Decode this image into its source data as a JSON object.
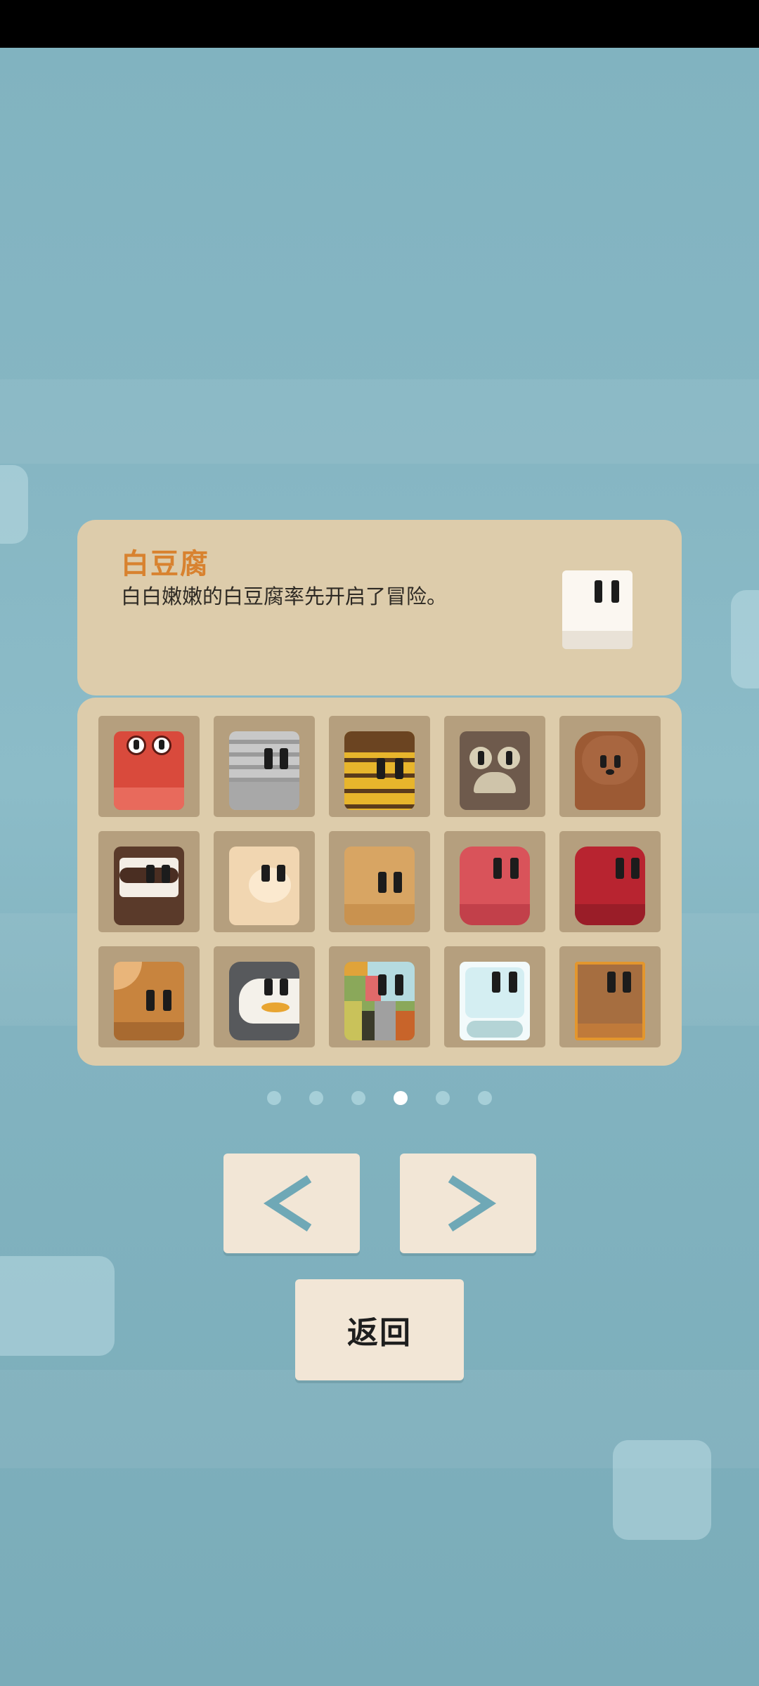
{
  "status_bar": {},
  "info": {
    "title": "白豆腐",
    "description": "白白嫩嫩的白豆腐率先开启了冒险。",
    "title_color": "#d8822f"
  },
  "characters": [
    {
      "icon": "crab-icon"
    },
    {
      "icon": "tabby-cat-icon"
    },
    {
      "icon": "bee-icon"
    },
    {
      "icon": "owl-icon"
    },
    {
      "icon": "poodle-icon"
    },
    {
      "icon": "raccoon-icon"
    },
    {
      "icon": "cream-cat-icon"
    },
    {
      "icon": "fox-icon"
    },
    {
      "icon": "strawberry-icon"
    },
    {
      "icon": "red-octopus-icon"
    },
    {
      "icon": "hermit-crab-icon"
    },
    {
      "icon": "penguin-icon"
    },
    {
      "icon": "patchwork-icon"
    },
    {
      "icon": "ice-cube-icon"
    },
    {
      "icon": "wooden-crate-icon"
    }
  ],
  "pagination": {
    "total": 6,
    "current": 4
  },
  "buttons": {
    "prev_icon": "chevron-left-icon",
    "next_icon": "chevron-right-icon",
    "back_label": "返回"
  },
  "colors": {
    "accent": "#6fa8b6",
    "card": "#ddccab",
    "tile": "#b59f7e"
  }
}
